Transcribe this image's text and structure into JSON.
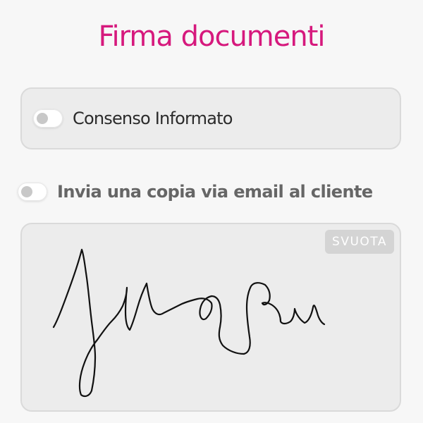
{
  "header": {
    "title": "Firma documenti"
  },
  "consent": {
    "label": "Consenso Informato",
    "enabled": false
  },
  "email_copy": {
    "label": "Invia una copia via email al cliente",
    "enabled": false
  },
  "signature": {
    "clear_label": "SVUOTA",
    "has_signature": true
  },
  "colors": {
    "accent": "#d6197d",
    "card_background": "#ececec",
    "toggle_off_knob": "#c8c8c8"
  }
}
